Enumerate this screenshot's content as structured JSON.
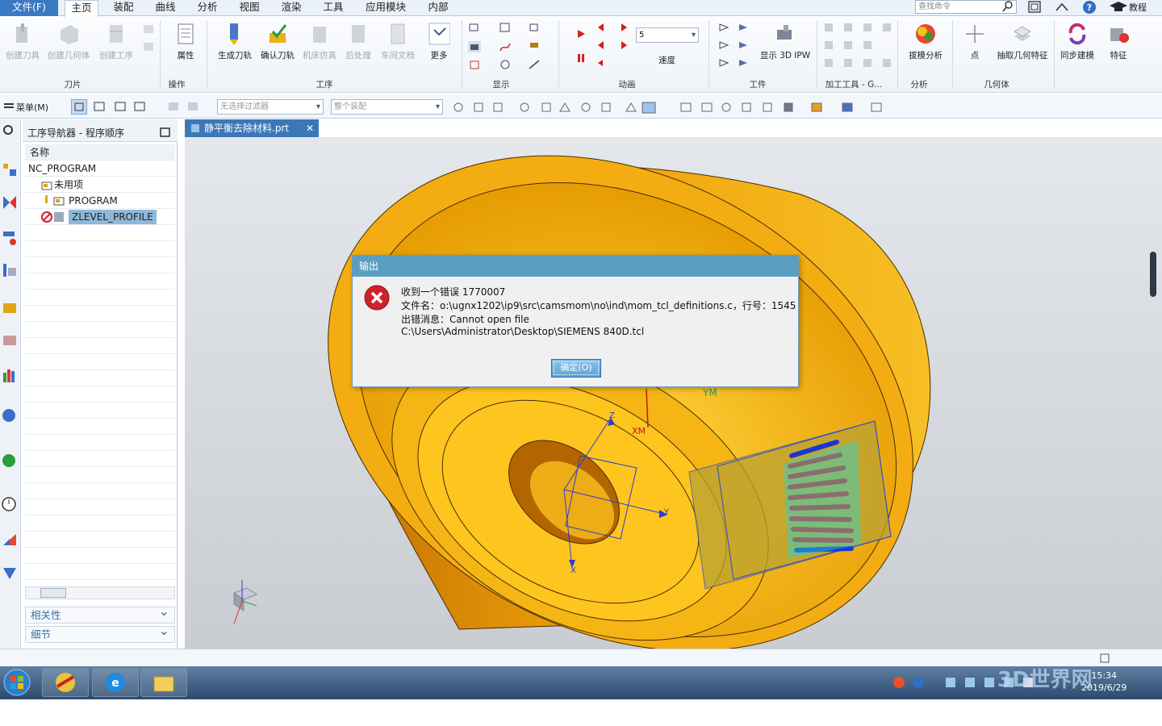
{
  "menu": {
    "file": "文件(F)",
    "tabs": [
      "主页",
      "装配",
      "曲线",
      "分析",
      "视图",
      "渲染",
      "工具",
      "应用模块",
      "内部"
    ],
    "search_placeholder": "查找命令",
    "tutorial": "教程"
  },
  "ribbon": {
    "create_tool": "创建刀具",
    "create_geometry": "创建几何体",
    "create_operation": "创建工序",
    "properties": "属性",
    "generate_path": "生成刀轨",
    "verify_path": "确认刀轨",
    "machine_sim": "机床仿真",
    "postprocess": "后处理",
    "shop_doc": "车间文档",
    "more": "更多",
    "speed_value": "5",
    "speed": "速度",
    "show_3d_ipw": "显示 3D IPW",
    "draft_analysis": "拔模分析",
    "point": "点",
    "extract_geometry": "抽取几何特征",
    "sync_modeling": "同步建模",
    "feature": "特征",
    "groups": {
      "blade": "刀片",
      "operation": "操作",
      "process": "工序",
      "display": "显示",
      "animation": "动画",
      "workpiece": "工件",
      "machining_tools": "加工工具 - G...",
      "analysis": "分析",
      "geometry": "几何体"
    }
  },
  "toolbar2": {
    "menu": "菜单(M)",
    "filter_placeholder": "无选择过滤器",
    "assembly_placeholder": "整个装配"
  },
  "navigator": {
    "title": "工序导航器 - 程序顺序",
    "column_name": "名称",
    "items": [
      "NC_PROGRAM",
      "未用项",
      "PROGRAM",
      "ZLEVEL_PROFILE"
    ],
    "related": "相关性",
    "details": "细节"
  },
  "document_tab": "静平衡去除材料.prt",
  "viewport_labels": {
    "ym": "YM",
    "xm": "XM",
    "x": "X",
    "y": "Y",
    "z": "Z"
  },
  "dialog": {
    "title": "输出",
    "line1": "收到一个错误 1770007",
    "line2": "文件名：o:\\ugnx1202\\ip9\\src\\camsmom\\no\\ind\\mom_tcl_definitions.c，行号：1545",
    "line3": "出错消息：Cannot open file",
    "line4": "C:\\Users\\Administrator\\Desktop\\SIEMENS 840D.tcl",
    "ok": "确定(O)"
  },
  "taskbar": {
    "time": "15:34",
    "date": "2019/6/29"
  },
  "watermark": "3D世界网",
  "colors": {
    "part": "#f2b10c",
    "accent": "#3b78b7",
    "dialog_title": "#5a9fc2",
    "error": "#d0212c"
  }
}
